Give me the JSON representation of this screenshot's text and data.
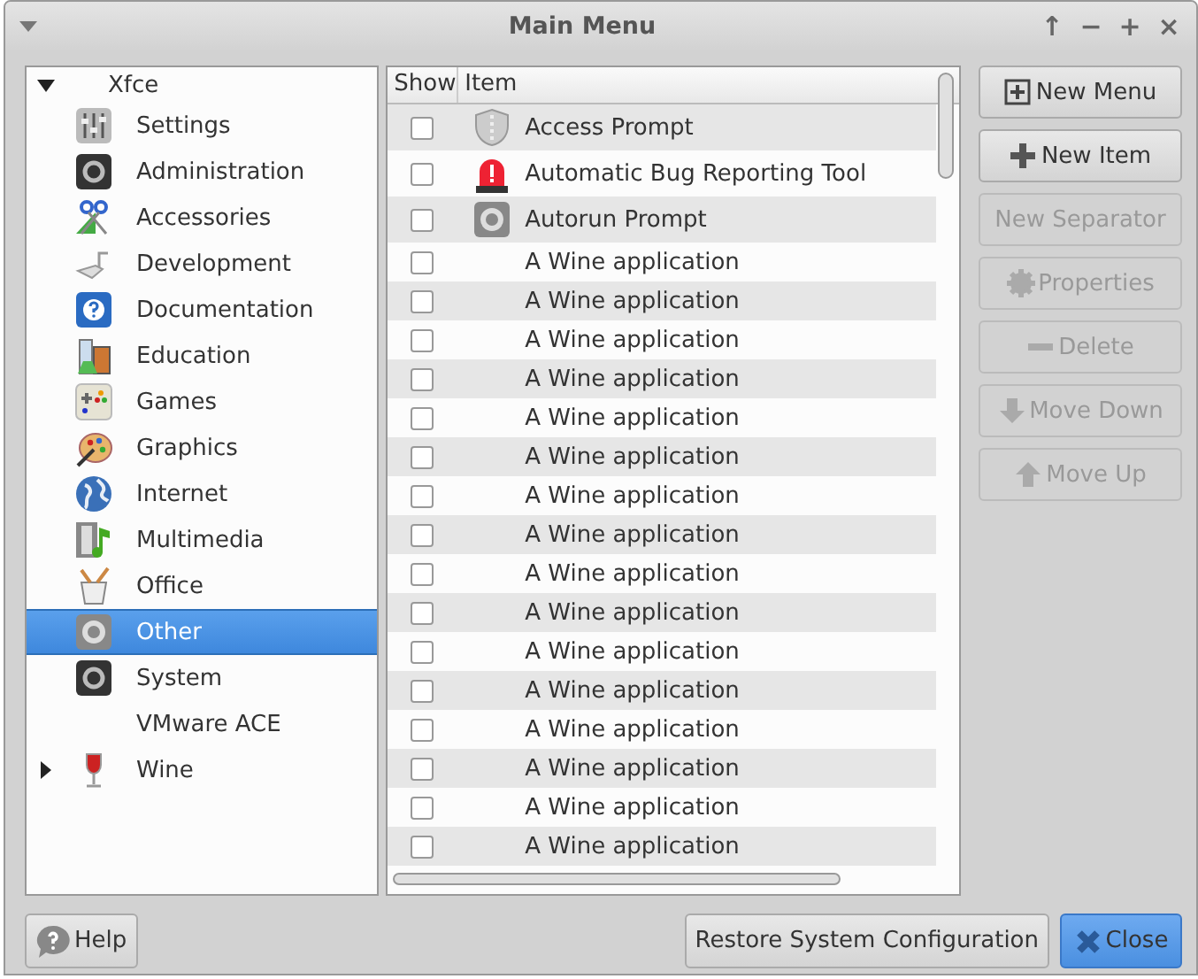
{
  "window": {
    "title": "Main Menu",
    "controls": [
      "↑",
      "−",
      "+",
      "×"
    ]
  },
  "tree": [
    {
      "label": "Xfce",
      "expanded": true,
      "selected": false,
      "children": [
        {
          "label": "Settings",
          "selected": false
        },
        {
          "label": "Administration",
          "selected": false
        },
        {
          "label": "Accessories",
          "selected": false
        },
        {
          "label": "Development",
          "selected": false
        },
        {
          "label": "Documentation",
          "selected": false
        },
        {
          "label": "Education",
          "selected": false
        },
        {
          "label": "Games",
          "selected": false
        },
        {
          "label": "Graphics",
          "selected": false
        },
        {
          "label": "Internet",
          "selected": false
        },
        {
          "label": "Multimedia",
          "selected": false
        },
        {
          "label": "Office",
          "selected": false
        },
        {
          "label": "Other",
          "selected": true
        },
        {
          "label": "System",
          "selected": false
        },
        {
          "label": "VMware ACE",
          "selected": false
        },
        {
          "label": "Wine",
          "expanded": false,
          "selected": false
        }
      ]
    }
  ],
  "table": {
    "columns": [
      "Show",
      "Item"
    ],
    "rows": [
      {
        "show": false,
        "item": "Access Prompt"
      },
      {
        "show": false,
        "item": "Automatic Bug Reporting Tool"
      },
      {
        "show": false,
        "item": "Autorun Prompt"
      },
      {
        "show": false,
        "item": "A Wine application"
      },
      {
        "show": false,
        "item": "A Wine application"
      },
      {
        "show": false,
        "item": "A Wine application"
      },
      {
        "show": false,
        "item": "A Wine application"
      },
      {
        "show": false,
        "item": "A Wine application"
      },
      {
        "show": false,
        "item": "A Wine application"
      },
      {
        "show": false,
        "item": "A Wine application"
      },
      {
        "show": false,
        "item": "A Wine application"
      },
      {
        "show": false,
        "item": "A Wine application"
      },
      {
        "show": false,
        "item": "A Wine application"
      },
      {
        "show": false,
        "item": "A Wine application"
      },
      {
        "show": false,
        "item": "A Wine application"
      },
      {
        "show": false,
        "item": "A Wine application"
      },
      {
        "show": false,
        "item": "A Wine application"
      },
      {
        "show": false,
        "item": "A Wine application"
      },
      {
        "show": false,
        "item": "A Wine application"
      }
    ]
  },
  "side_buttons": [
    {
      "label": "New Menu",
      "disabled": false
    },
    {
      "label": "New Item",
      "disabled": false
    },
    {
      "label": "New Separator",
      "disabled": true
    },
    {
      "label": "Properties",
      "disabled": true
    },
    {
      "label": "Delete",
      "disabled": true
    },
    {
      "label": "Move Down",
      "disabled": true
    },
    {
      "label": "Move Up",
      "disabled": true
    }
  ],
  "footer": {
    "help": "Help",
    "restore": "Restore System Configuration",
    "close": "Close"
  }
}
